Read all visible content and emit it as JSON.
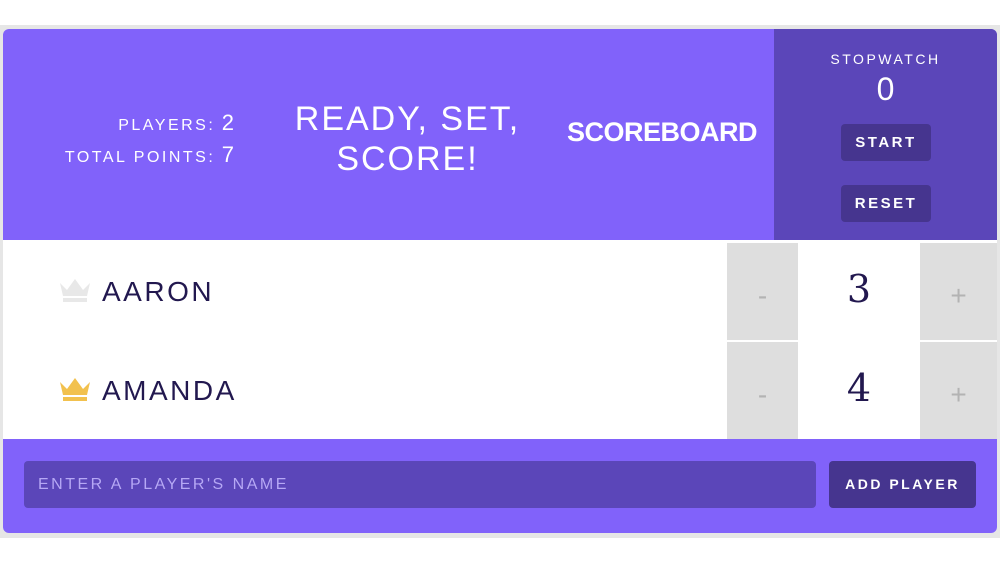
{
  "header": {
    "stats": {
      "players_label": "PLAYERS:",
      "players_value": "2",
      "points_label": "TOTAL POINTS:",
      "points_value": "7"
    },
    "tagline_line1": "READY, SET,",
    "tagline_line2": "SCORE!",
    "title": "SCOREBOARD"
  },
  "stopwatch": {
    "label": "STOPWATCH",
    "time": "0",
    "start_label": "START",
    "reset_label": "RESET"
  },
  "players": [
    {
      "name": "AARON",
      "score": "3",
      "leader": false,
      "crown_color": "#e8e8e8",
      "minus": "-",
      "plus": "+"
    },
    {
      "name": "AMANDA",
      "score": "4",
      "leader": true,
      "crown_color": "#f2c14e",
      "minus": "-",
      "plus": "+"
    }
  ],
  "add_player": {
    "placeholder": "ENTER A PLAYER'S NAME",
    "value": "",
    "button_label": "ADD PLAYER"
  },
  "colors": {
    "accent": "#8162fa",
    "panel": "#5b46b9",
    "button": "#46358f",
    "text_dark": "#22184f",
    "control_bg": "#dedede"
  },
  "icons": {
    "crown": "crown-icon"
  }
}
